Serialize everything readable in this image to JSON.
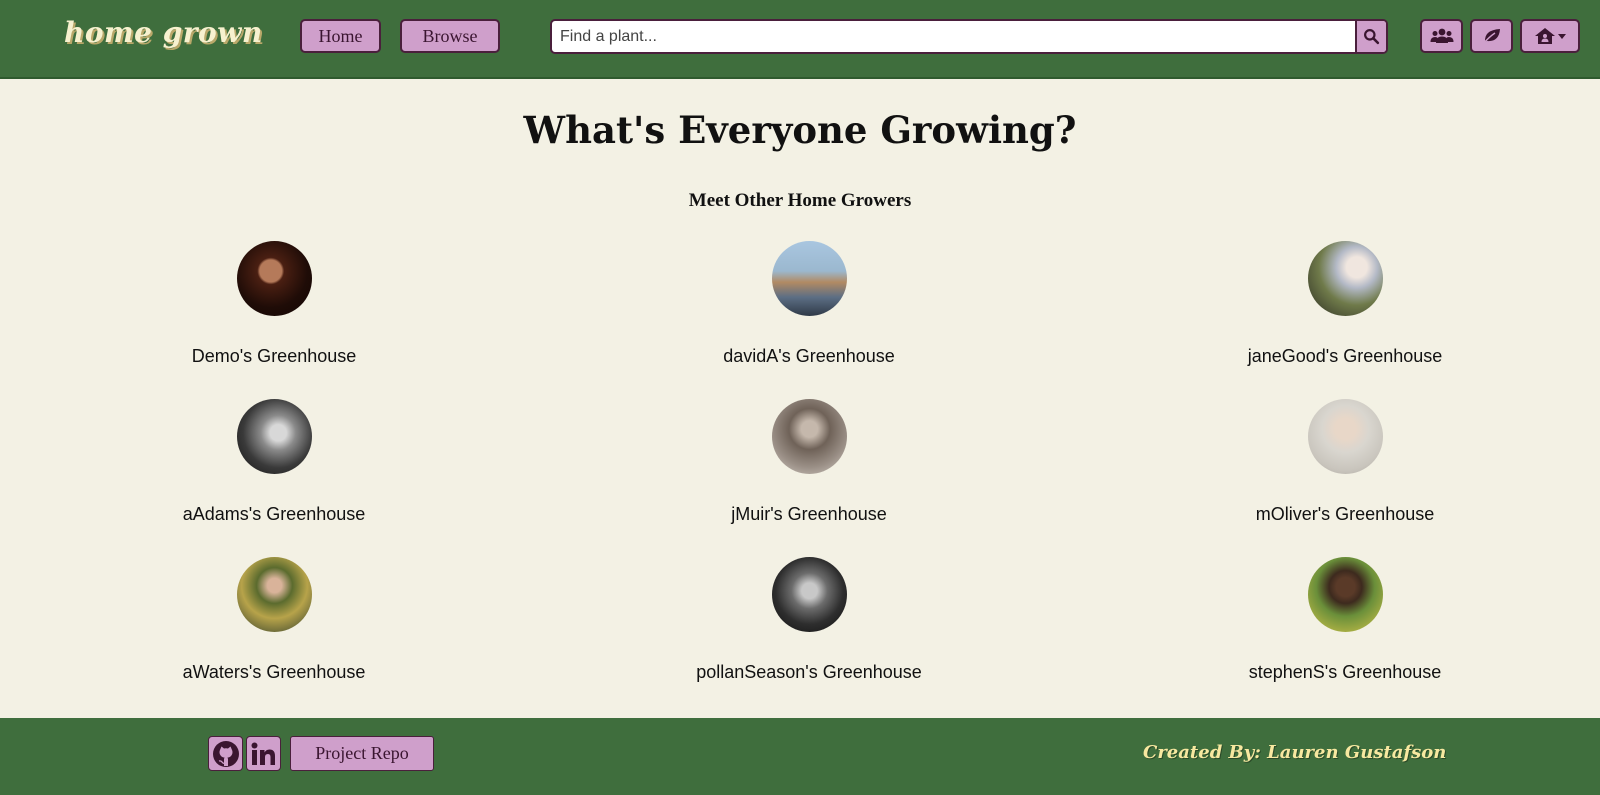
{
  "nav": {
    "logo": "home grown",
    "home_label": "Home",
    "browse_label": "Browse",
    "search_placeholder": "Find a plant...",
    "icons": [
      "search-icon",
      "users-icon",
      "leaf-icon",
      "house-user-icon",
      "caret-down-icon"
    ]
  },
  "main": {
    "title": "What's Everyone Growing?",
    "subtitle": "Meet Other Home Growers",
    "growers": [
      {
        "label": "Demo's Greenhouse"
      },
      {
        "label": "davidA's Greenhouse"
      },
      {
        "label": "janeGood's Greenhouse"
      },
      {
        "label": "aAdams's Greenhouse"
      },
      {
        "label": "jMuir's Greenhouse"
      },
      {
        "label": "mOliver's Greenhouse"
      },
      {
        "label": "aWaters's Greenhouse"
      },
      {
        "label": "pollanSeason's Greenhouse"
      },
      {
        "label": "stephenS's Greenhouse"
      }
    ]
  },
  "footer": {
    "repo_label": "Project Repo",
    "credit": "Created By: Lauren Gustafson",
    "icons": [
      "github-icon",
      "linkedin-icon"
    ]
  },
  "colors": {
    "nav_green": "#3f6e3d",
    "button_pink": "#cf9fcb",
    "button_border": "#4a1f3c",
    "background": "#f3f1e4",
    "logo_cream": "#f7f1cf",
    "credit_yellow": "#f7e8a0"
  }
}
